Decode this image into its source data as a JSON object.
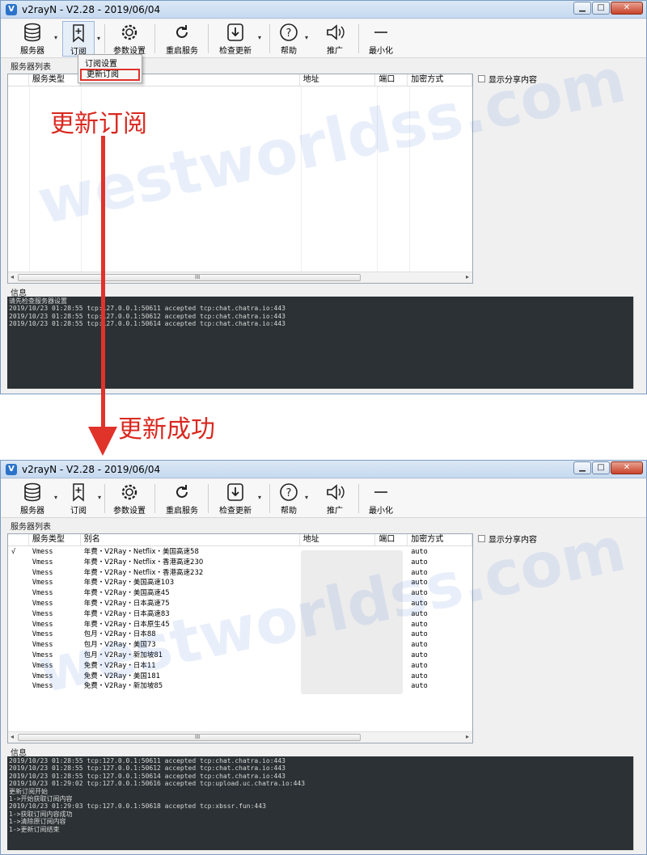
{
  "window_title": "v2rayN - V2.28 - 2019/06/04",
  "window_controls": {
    "minimize": "▁",
    "maximize": "□",
    "close": "✕"
  },
  "toolbar": [
    {
      "label": "服务器",
      "icon": "database-icon",
      "has_dropdown": true
    },
    {
      "label": "订阅",
      "icon": "bookmark-plus-icon",
      "has_dropdown": true
    },
    {
      "label": "参数设置",
      "icon": "gear-icon",
      "has_dropdown": false
    },
    {
      "label": "重启服务",
      "icon": "refresh-icon",
      "has_dropdown": false
    },
    {
      "label": "检查更新",
      "icon": "download-icon",
      "has_dropdown": true
    },
    {
      "label": "帮助",
      "icon": "help-icon",
      "has_dropdown": true
    },
    {
      "label": "推广",
      "icon": "speaker-icon",
      "has_dropdown": false
    },
    {
      "label": "最小化",
      "icon": "minimize-dash-icon",
      "has_dropdown": false
    }
  ],
  "labels": {
    "server_list": "服务器列表",
    "info": "信息",
    "share": "显示分享内容"
  },
  "columns": [
    "",
    "服务类型",
    "别名",
    "地址",
    "端口",
    "加密方式"
  ],
  "subscription_menu": {
    "items": [
      "订阅设置",
      "更新订阅"
    ],
    "highlighted": "更新订阅"
  },
  "before": {
    "rows": [],
    "log": [
      "请先检查服务器设置",
      "2019/10/23 01:28:55 tcp:127.0.0.1:50611 accepted tcp:chat.chatra.io:443",
      "2019/10/23 01:28:55 tcp:127.0.0.1:50612 accepted tcp:chat.chatra.io:443",
      "2019/10/23 01:28:55 tcp:127.0.0.1:50614 accepted tcp:chat.chatra.io:443"
    ]
  },
  "after": {
    "rows": [
      {
        "mark": "√",
        "type": "Vmess",
        "alias": "年费・V2Ray・Netflix・美国高速58",
        "security": "auto"
      },
      {
        "mark": "",
        "type": "Vmess",
        "alias": "年费・V2Ray・Netflix・香港高速230",
        "security": "auto"
      },
      {
        "mark": "",
        "type": "Vmess",
        "alias": "年费・V2Ray・Netflix・香港高速232",
        "security": "auto"
      },
      {
        "mark": "",
        "type": "Vmess",
        "alias": "年费・V2Ray・美国高速103",
        "security": "auto"
      },
      {
        "mark": "",
        "type": "Vmess",
        "alias": "年费・V2Ray・美国高速45",
        "security": "auto"
      },
      {
        "mark": "",
        "type": "Vmess",
        "alias": "年费・V2Ray・日本高速75",
        "security": "auto"
      },
      {
        "mark": "",
        "type": "Vmess",
        "alias": "年费・V2Ray・日本高速83",
        "security": "auto"
      },
      {
        "mark": "",
        "type": "Vmess",
        "alias": "年费・V2Ray・日本原生45",
        "security": "auto"
      },
      {
        "mark": "",
        "type": "Vmess",
        "alias": "包月・V2Ray・日本88",
        "security": "auto"
      },
      {
        "mark": "",
        "type": "Vmess",
        "alias": "包月・V2Ray・美国73",
        "security": "auto"
      },
      {
        "mark": "",
        "type": "Vmess",
        "alias": "包月・V2Ray・新加坡81",
        "security": "auto"
      },
      {
        "mark": "",
        "type": "Vmess",
        "alias": "免费・V2Ray・日本11",
        "security": "auto"
      },
      {
        "mark": "",
        "type": "Vmess",
        "alias": "免费・V2Ray・美国181",
        "security": "auto"
      },
      {
        "mark": "",
        "type": "Vmess",
        "alias": "免费・V2Ray・新加坡85",
        "security": "auto"
      }
    ],
    "log": [
      "2019/10/23 01:28:55 tcp:127.0.0.1:50611 accepted tcp:chat.chatra.io:443",
      "2019/10/23 01:28:55 tcp:127.0.0.1:50612 accepted tcp:chat.chatra.io:443",
      "2019/10/23 01:28:55 tcp:127.0.0.1:50614 accepted tcp:chat.chatra.io:443",
      "2019/10/23 01:29:02 tcp:127.0.0.1:50616 accepted tcp:upload.uc.chatra.io:443",
      "更新订阅开始",
      "1->开始获取订阅内容",
      "2019/10/23 01:29:03 tcp:127.0.0.1:50618 accepted tcp:xbssr.fun:443",
      "1->获取订阅内容成功",
      "1->清除原订阅内容",
      "1->更新订阅结束"
    ]
  },
  "annotations": {
    "top": "更新订阅",
    "bottom": "更新成功",
    "arrow_color": "#e0332a"
  },
  "watermark": "westworldss.com",
  "hscroll_grip": "III",
  "scroll_arrows": {
    "left": "◂",
    "right": "▸"
  }
}
